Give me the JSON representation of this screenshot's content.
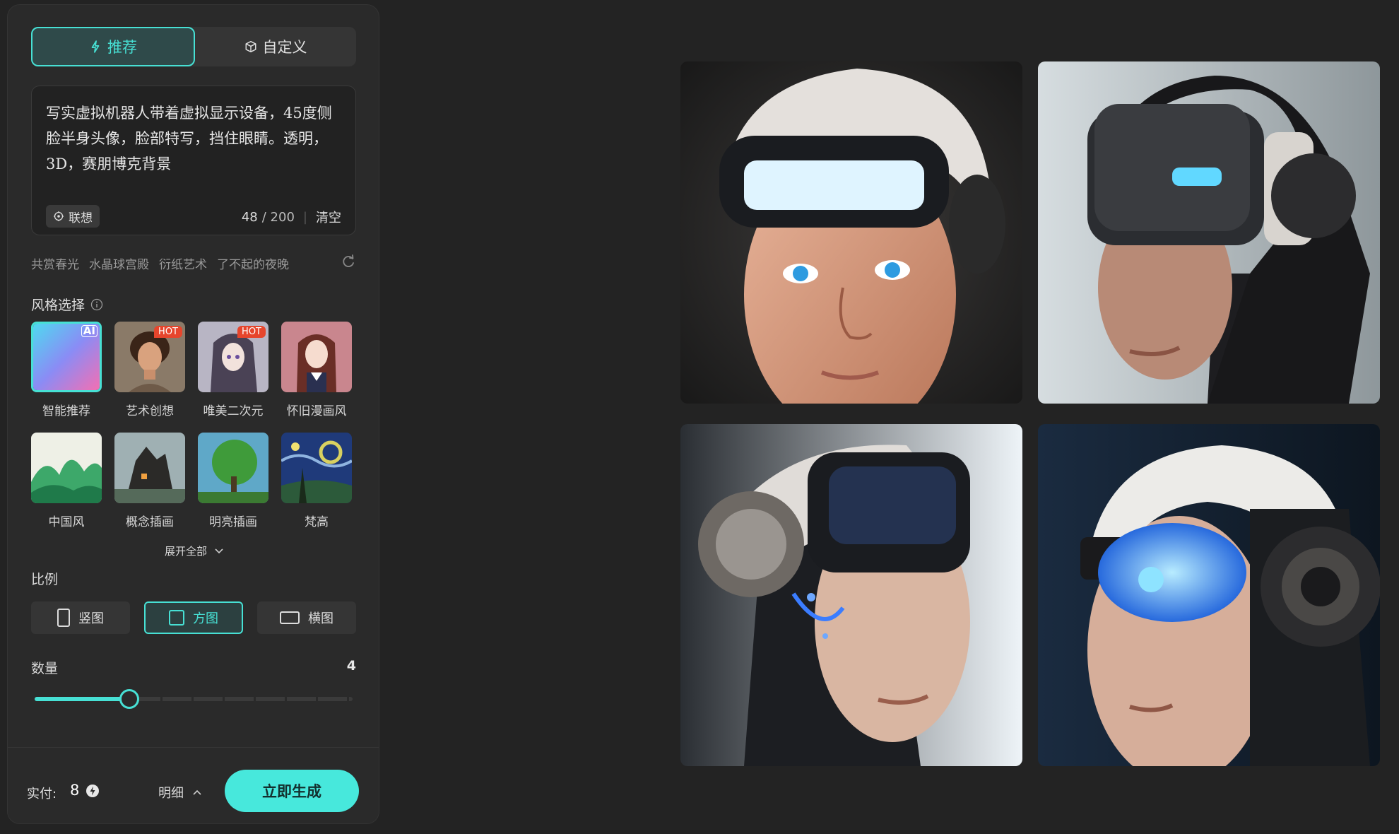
{
  "mode_tabs": [
    {
      "label": "推荐",
      "icon": "lightning-icon",
      "active": true
    },
    {
      "label": "自定义",
      "icon": "cube-icon",
      "active": false
    }
  ],
  "prompt": {
    "text": "写实虚拟机器人带着虚拟显示设备，45度侧脸半身头像，脸部特写，挡住眼睛。透明，3D，赛朋博克背景",
    "assoc_label": "联想",
    "count_current": "48",
    "count_max": "/ 200",
    "clear_label": "清空"
  },
  "suggestions": [
    "共赏春光",
    "水晶球宫殿",
    "衍纸艺术",
    "了不起的夜晚"
  ],
  "style_section": {
    "title": "风格选择"
  },
  "styles": [
    {
      "label": "智能推荐",
      "badge": "AI",
      "selected": true
    },
    {
      "label": "艺术创想",
      "badge": "HOT"
    },
    {
      "label": "唯美二次元",
      "badge": "HOT"
    },
    {
      "label": "怀旧漫画风",
      "badge": ""
    },
    {
      "label": "中国风",
      "badge": ""
    },
    {
      "label": "概念插画",
      "badge": ""
    },
    {
      "label": "明亮插画",
      "badge": ""
    },
    {
      "label": "梵高",
      "badge": ""
    }
  ],
  "expand_label": "展开全部",
  "ratio_section": {
    "title": "比例"
  },
  "ratios": [
    {
      "label": "竖图",
      "shape": "portrait"
    },
    {
      "label": "方图",
      "shape": "square",
      "selected": true
    },
    {
      "label": "横图",
      "shape": "landscape"
    }
  ],
  "quantity": {
    "title": "数量",
    "value": "4",
    "min": 1,
    "max": 10,
    "current": 4
  },
  "footer": {
    "pay_label": "实付:",
    "pay_value": "8",
    "detail_label": "明细",
    "generate_label": "立即生成"
  },
  "colors": {
    "accent": "#47e0d4",
    "panel_bg": "#2a2a2a",
    "page_bg": "#232323",
    "hot_badge": "#e6452c"
  }
}
